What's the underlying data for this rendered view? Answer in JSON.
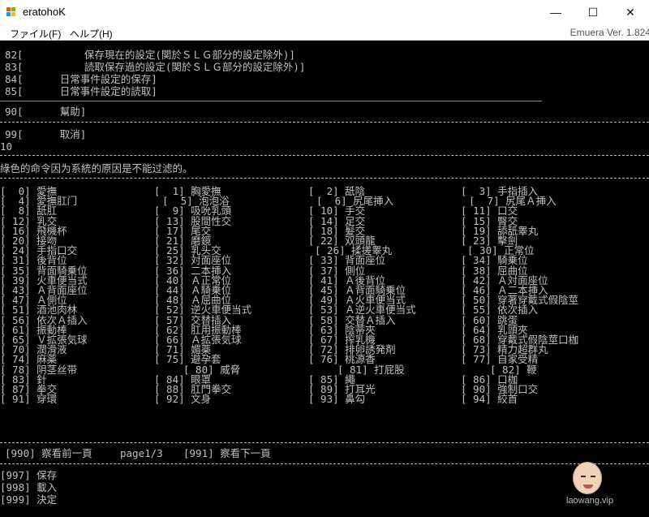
{
  "window": {
    "title": "eratohoK",
    "minimize": "—",
    "maximize": "☐",
    "close": "✕"
  },
  "menu": {
    "file": "ファイル(F)",
    "help": "ヘルプ(H)",
    "version": "Emuera Ver. 1.824"
  },
  "console": {
    "top_lines": [
      "82[          保存現在的設定(関於ＳＬＧ部分的設定除外)]",
      "83[          読取保存過的設定(関於ＳＬＧ部分的設定除外)]",
      "84[      日常事件設定的保存]",
      "85[      日常事件設定的読取]"
    ],
    "help_line": "90[      幫助]",
    "cancel_line": "99[      取消]",
    "input_echo": "10",
    "notice": "綠色的命令因为系統的原因是不能过滤的。",
    "commands": [
      [
        {
          "t": "[  0] 愛撫"
        },
        {
          "t": "[  1] 胸愛撫"
        },
        {
          "t": "[  2] 舐陰"
        },
        {
          "t": "[  3] 手指插入"
        }
      ],
      [
        {
          "t": "[  4] 愛撫肛门"
        },
        {
          "t": "[  5] 泡泡浴"
        },
        {
          "t": "[  6] 尻尾挿入"
        },
        {
          "t": "[  7] 尻尾Ａ挿入"
        }
      ],
      [
        {
          "t": "[  8] 舐肛"
        },
        {
          "t": "[  9] 吸吮乳頭"
        },
        {
          "t": "[ 10] 手交"
        },
        {
          "t": "[ 11] 口交"
        }
      ],
      [
        {
          "t": "[ 12] 乳交"
        },
        {
          "t": "[ 13] 股間性交"
        },
        {
          "t": "[ 14] 足交"
        },
        {
          "t": "[ 15] 臀交"
        }
      ],
      [
        {
          "t": "[ 16] 飛機杯"
        },
        {
          "t": "[ 17] 尾交"
        },
        {
          "t": "[ 18] 髮交"
        },
        {
          "t": "[ 19] 舔舐睾丸"
        }
      ],
      [
        {
          "t": "[ 20] 接吻"
        },
        {
          "t": "[ 21] 磨鏡"
        },
        {
          "t": "[ 22] 双頭龍"
        },
        {
          "t": "[ 23] 擊劍"
        }
      ],
      [
        {
          "t": "[ 24] 手指口交"
        },
        {
          "t": "[ 25] 乳头交"
        },
        {
          "t": "[ 26] 揉搓睾丸"
        },
        {
          "t": "[ 30] 正常位"
        }
      ],
      [
        {
          "t": "[ 31] 後背位"
        },
        {
          "t": "[ 32] 対面座位"
        },
        {
          "t": "[ 33] 背面座位"
        },
        {
          "t": "[ 34] 騎乗位"
        }
      ],
      [
        {
          "t": "[ 35] 背面騎乗位"
        },
        {
          "t": "[ 36] 二本挿入"
        },
        {
          "t": "[ 37] 側位"
        },
        {
          "t": "[ 38] 屈曲位"
        }
      ],
      [
        {
          "t": "[ 39] 火車便当式"
        },
        {
          "t": "[ 40] Ａ正常位"
        },
        {
          "t": "[ 41] Ａ後背位"
        },
        {
          "t": "[ 42] Ａ対面座位"
        }
      ],
      [
        {
          "t": "[ 43] Ａ背面座位"
        },
        {
          "t": "[ 44] Ａ騎乗位"
        },
        {
          "t": "[ 45] Ａ背面騎乗位"
        },
        {
          "t": "[ 46] Ａ二本挿入"
        }
      ],
      [
        {
          "t": "[ 47] Ａ側位"
        },
        {
          "t": "[ 48] Ａ屈曲位"
        },
        {
          "t": "[ 49] Ａ火車便当式"
        },
        {
          "t": "[ 50] 穿著穿戴式假陰莖"
        }
      ],
      [
        {
          "t": "[ 51] 酒池肉林"
        },
        {
          "t": "[ 52] 逆火車便当式"
        },
        {
          "t": "[ 53] Ａ逆火車便当式"
        },
        {
          "t": "[ 55] 依次插入"
        }
      ],
      [
        {
          "t": "[ 56] 依次Ａ插入"
        },
        {
          "t": "[ 57] 交替插入"
        },
        {
          "t": "[ 58] 交替Ａ插入"
        },
        {
          "t": "[ 60] 跳蛋"
        }
      ],
      [
        {
          "t": "[ 61] 振動棒"
        },
        {
          "t": "[ 62] 肛用振動棒"
        },
        {
          "t": "[ 63] 陰蒂夾"
        },
        {
          "t": "[ 64] 乳頭夾"
        }
      ],
      [
        {
          "t": "[ 65] Ｖ拡張気球"
        },
        {
          "t": "[ 66] Ａ拡張気球"
        },
        {
          "t": "[ 67] 搾乳機"
        },
        {
          "t": "[ 68] 穿戴式假陰莖口枷"
        }
      ],
      [
        {
          "t": "[ 70] 潤滑液"
        },
        {
          "t": "[ 71] 媚薬"
        },
        {
          "t": "[ 72] 排卵誘発剤"
        },
        {
          "t": "[ 73] 精力超群丸"
        }
      ],
      [
        {
          "t": "[ 74] 麻薬"
        },
        {
          "t": "[ 75] 避孕套"
        },
        {
          "t": "[ 76] 桃源香"
        },
        {
          "t": "[ 77] 自家受精"
        }
      ],
      [
        {
          "t": "[ 78] 阴茎丝带"
        },
        {
          "t": "[ 80] 威脅"
        },
        {
          "t": "[ 81] 打屁股"
        },
        {
          "t": "[ 82] 鞭"
        }
      ],
      [
        {
          "t": "[ 83] 針"
        },
        {
          "t": "[ 84] 眼罩"
        },
        {
          "t": "[ 85] 繩"
        },
        {
          "t": "[ 86] 口枷"
        }
      ],
      [
        {
          "t": "[ 87] 拳交"
        },
        {
          "t": "[ 88] 肛門拳交"
        },
        {
          "t": "[ 89] 打耳光"
        },
        {
          "t": "[ 90] 強制口交"
        }
      ],
      [
        {
          "t": "[ 91] 穿環"
        },
        {
          "t": "[ 92] 文身"
        },
        {
          "t": "[ 93] 鼻勾"
        },
        {
          "t": "[ 94] 絞首"
        }
      ]
    ],
    "paging": {
      "prev": "[990] 察看前一頁",
      "page": "page1/3",
      "next": "[991] 察看下一頁"
    },
    "bottom": {
      "save": "[997] 保存",
      "load": "[998] 載入",
      "decide": "[999] 決定"
    }
  },
  "watermark": {
    "text": "laowang.vip"
  }
}
